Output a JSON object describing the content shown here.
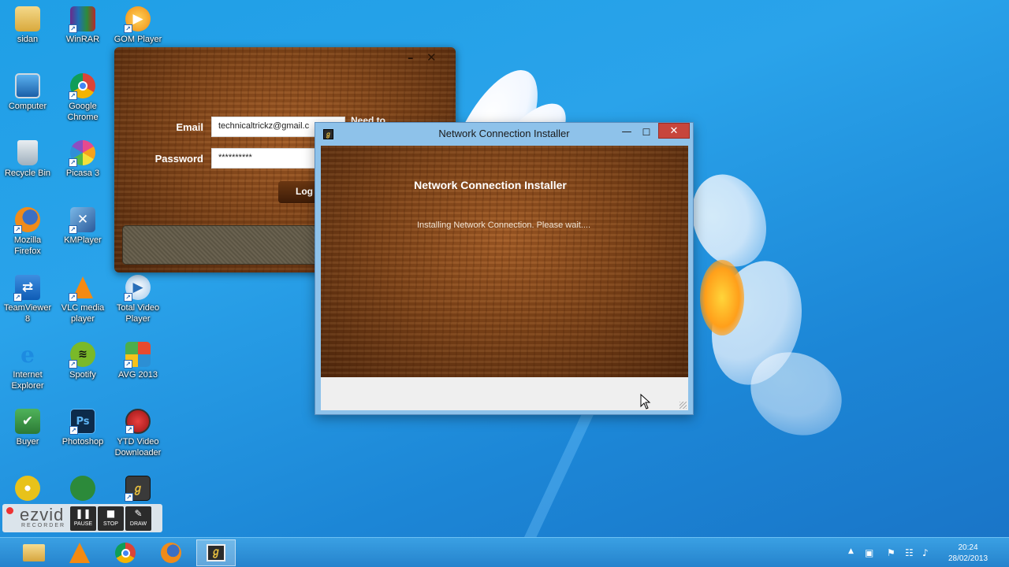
{
  "desktop": {
    "icons": [
      {
        "label": "sidan",
        "icon": "folder-icon"
      },
      {
        "label": "WinRAR",
        "icon": "winrar-icon"
      },
      {
        "label": "GOM Player",
        "icon": "gom-player-icon"
      },
      {
        "label": "Computer",
        "icon": "computer-icon"
      },
      {
        "label": "Google\nChrome",
        "icon": "chrome-icon"
      },
      {
        "label": "Recycle Bin",
        "icon": "recycle-bin-icon"
      },
      {
        "label": "Picasa 3",
        "icon": "picasa-icon"
      },
      {
        "label": "Mozilla\nFirefox",
        "icon": "firefox-icon"
      },
      {
        "label": "KMPlayer",
        "icon": "kmplayer-icon"
      },
      {
        "label": "TeamViewer\n8",
        "icon": "teamviewer-icon"
      },
      {
        "label": "VLC media\nplayer",
        "icon": "vlc-icon"
      },
      {
        "label": "Total Video\nPlayer",
        "icon": "total-video-player-icon"
      },
      {
        "label": "Internet\nExplorer",
        "icon": "internet-explorer-icon"
      },
      {
        "label": "Spotify",
        "icon": "spotify-icon"
      },
      {
        "label": "AVG 2013",
        "icon": "avg-icon"
      },
      {
        "label": "Buyer",
        "icon": "buyer-icon"
      },
      {
        "label": "Photoshop",
        "icon": "photoshop-icon"
      },
      {
        "label": "YTD Video\nDownloader",
        "icon": "ytd-downloader-icon"
      }
    ]
  },
  "login_window": {
    "email_label": "Email",
    "email_value": "technicaltrickz@gmail.c",
    "password_label": "Password",
    "password_value": "**********",
    "login_button": "Log",
    "side_text": "Need to",
    "minimize": "–",
    "close": "✕"
  },
  "installer_window": {
    "title": "Network Connection Installer",
    "heading": "Network Connection Installer",
    "status": "Installing Network Connection. Please wait....",
    "minimize": "—",
    "maximize": "☐",
    "close": "✕"
  },
  "ezvid": {
    "logo": "ezvid",
    "subtitle": "RECORDER",
    "buttons": [
      {
        "label": "PAUSE",
        "icon": "pause-icon"
      },
      {
        "label": "STOP",
        "icon": "stop-icon"
      },
      {
        "label": "DRAW",
        "icon": "draw-icon"
      }
    ]
  },
  "taskbar": {
    "pinned": [
      {
        "name": "File Explorer",
        "icon": "file-explorer-icon"
      },
      {
        "name": "VLC media player",
        "icon": "vlc-icon"
      },
      {
        "name": "Google Chrome",
        "icon": "chrome-icon"
      },
      {
        "name": "Mozilla Firefox",
        "icon": "firefox-icon"
      },
      {
        "name": "Network Connection Installer",
        "icon": "installer-icon"
      }
    ],
    "clock_time": "20:24",
    "clock_date": "28/02/2013"
  }
}
